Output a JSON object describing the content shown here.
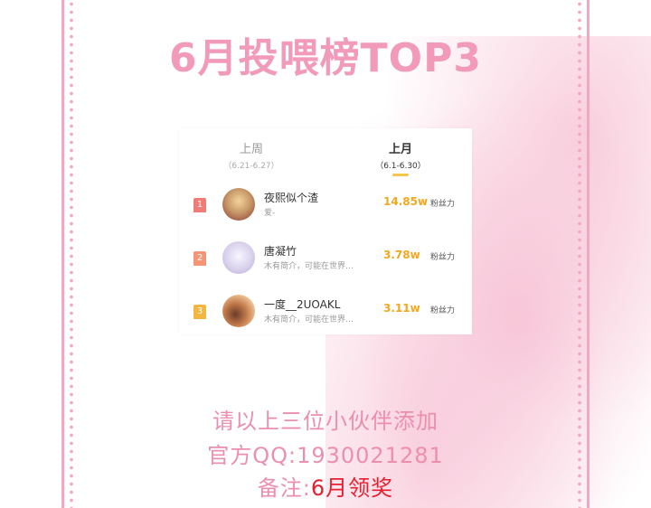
{
  "title": "6月投喂榜TOP3",
  "tabs": [
    {
      "label": "上周",
      "range": "（6.21-6.27）"
    },
    {
      "label": "上月",
      "range": "（6.1-6.30）"
    }
  ],
  "ranking": [
    {
      "rank": "1",
      "name": "夜熙似个渣",
      "desc": "爱-",
      "score": "14.85w",
      "unit": "粉丝力"
    },
    {
      "rank": "2",
      "name": "唐凝竹",
      "desc": "木有简介，可能在世界…",
      "score": "3.78w",
      "unit": "粉丝力"
    },
    {
      "rank": "3",
      "name": "一度__2UOAKL",
      "desc": "木有简介，可能在世界…",
      "score": "3.11w",
      "unit": "粉丝力"
    }
  ],
  "notice": {
    "line1": "请以上三位小伙伴添加",
    "line2": "官方QQ:1930021281",
    "line3_prefix": "备注:",
    "line3_highlight": "6月领奖"
  },
  "colors": {
    "title": "#f29ab9",
    "score": "#f0a91f",
    "highlight": "#e81e2e"
  }
}
